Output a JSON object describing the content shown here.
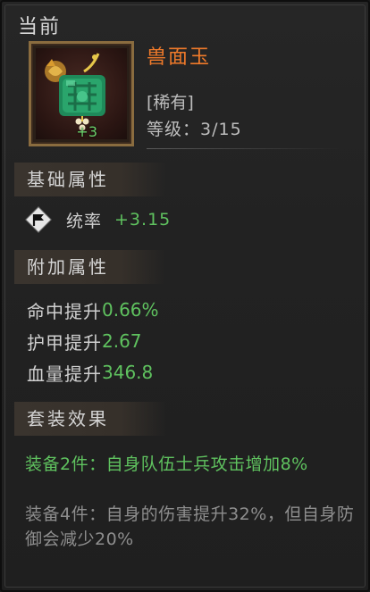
{
  "header": {
    "current_label": "当前"
  },
  "item": {
    "name": "兽面玉",
    "rarity": "[稀有]",
    "level_text": "等级：3/15",
    "enhance": "+3",
    "icon": "jade-pendant-icon"
  },
  "sections": {
    "base": "基础属性",
    "extra": "附加属性",
    "set": "套装效果"
  },
  "base_attr": {
    "icon": "flag-icon",
    "label": "统率",
    "value": "+3.15"
  },
  "extra_attrs": [
    {
      "label": "命中提升",
      "value": "0.66%"
    },
    {
      "label": "护甲提升",
      "value": "2.67"
    },
    {
      "label": "血量提升",
      "value": "346.8"
    }
  ],
  "set_effects": {
    "active": "装备2件：自身队伍士兵攻击增加8%",
    "inactive": "装备4件：自身的伤害提升32%，但自身防御会减少20%"
  },
  "colors": {
    "name": "#f07a2a",
    "positive": "#5fc25f",
    "inactive": "#8e8e8e",
    "frame": "#8a6c3f"
  }
}
